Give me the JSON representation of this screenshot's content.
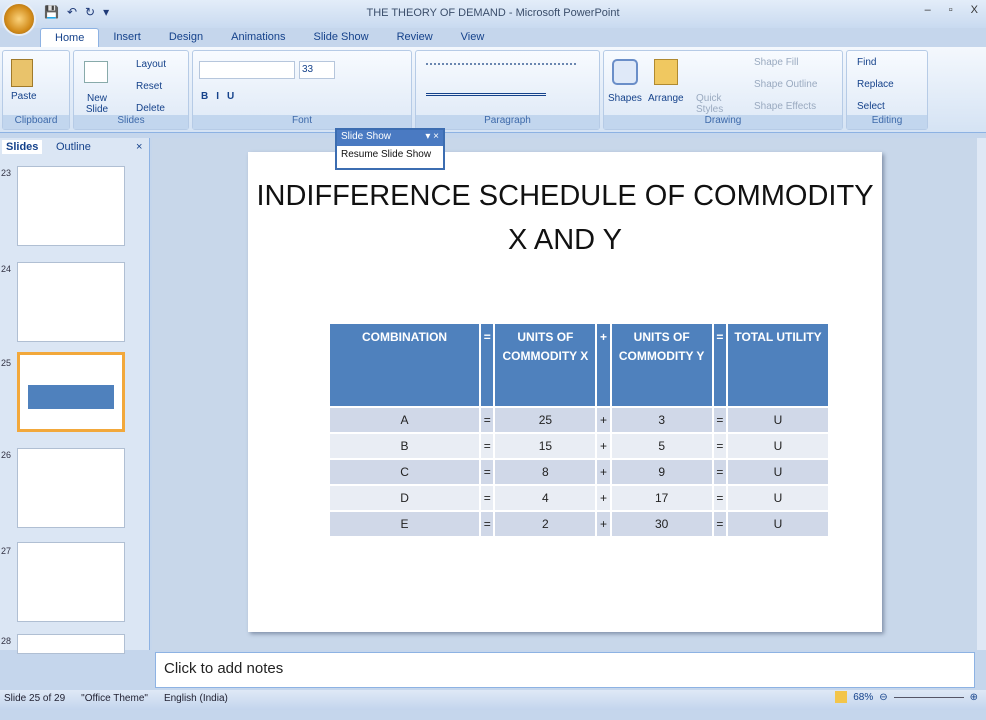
{
  "window": {
    "title": "THE THEORY OF DEMAND - Microsoft PowerPoint",
    "minimize": "–",
    "maximize": "▫",
    "close": "X"
  },
  "qat": {
    "save": "💾",
    "undo": "↶",
    "redo": "↻",
    "more": "▾"
  },
  "tabs": [
    "Home",
    "Insert",
    "Design",
    "Animations",
    "Slide Show",
    "Review",
    "View"
  ],
  "ribbon": {
    "clipboard": {
      "label": "Clipboard",
      "paste": "Paste"
    },
    "slides": {
      "label": "Slides",
      "new_slide": "New Slide",
      "layout": "Layout",
      "reset": "Reset",
      "delete": "Delete"
    },
    "font": {
      "label": "Font",
      "size": "33"
    },
    "paragraph": {
      "label": "Paragraph"
    },
    "drawing": {
      "label": "Drawing",
      "shapes": "Shapes",
      "arrange": "Arrange",
      "quick_styles": "Quick Styles",
      "shape_fill": "Shape Fill",
      "shape_outline": "Shape Outline",
      "shape_effects": "Shape Effects"
    },
    "editing": {
      "label": "Editing",
      "find": "Find",
      "replace": "Replace",
      "select": "Select"
    }
  },
  "pane": {
    "tabs": [
      "Slides",
      "Outline"
    ],
    "close": "×",
    "thumb_numbers": [
      "23",
      "24",
      "25",
      "26",
      "27",
      "28"
    ]
  },
  "slideshow_toolbar": {
    "title": "Slide Show",
    "resume": "Resume Slide Show"
  },
  "slide": {
    "title": "INDIFFERENCE SCHEDULE OF COMMODITY X AND Y",
    "headers": [
      "COMBINATION",
      "=",
      "UNITS OF COMMODITY X",
      "+",
      "UNITS OF COMMODITY Y",
      "=",
      "TOTAL UTILITY"
    ],
    "rows": [
      [
        "A",
        "=",
        "25",
        "+",
        "3",
        "=",
        "U"
      ],
      [
        "B",
        "=",
        "15",
        "+",
        "5",
        "=",
        "U"
      ],
      [
        "C",
        "=",
        "8",
        "+",
        "9",
        "=",
        "U"
      ],
      [
        "D",
        "=",
        "4",
        "+",
        "17",
        "=",
        "U"
      ],
      [
        "E",
        "=",
        "2",
        "+",
        "30",
        "=",
        "U"
      ]
    ]
  },
  "notes": {
    "placeholder": "Click to add notes"
  },
  "status": {
    "slide": "Slide 25 of 29",
    "theme": "\"Office Theme\"",
    "language": "English (India)",
    "zoom": "68%"
  }
}
